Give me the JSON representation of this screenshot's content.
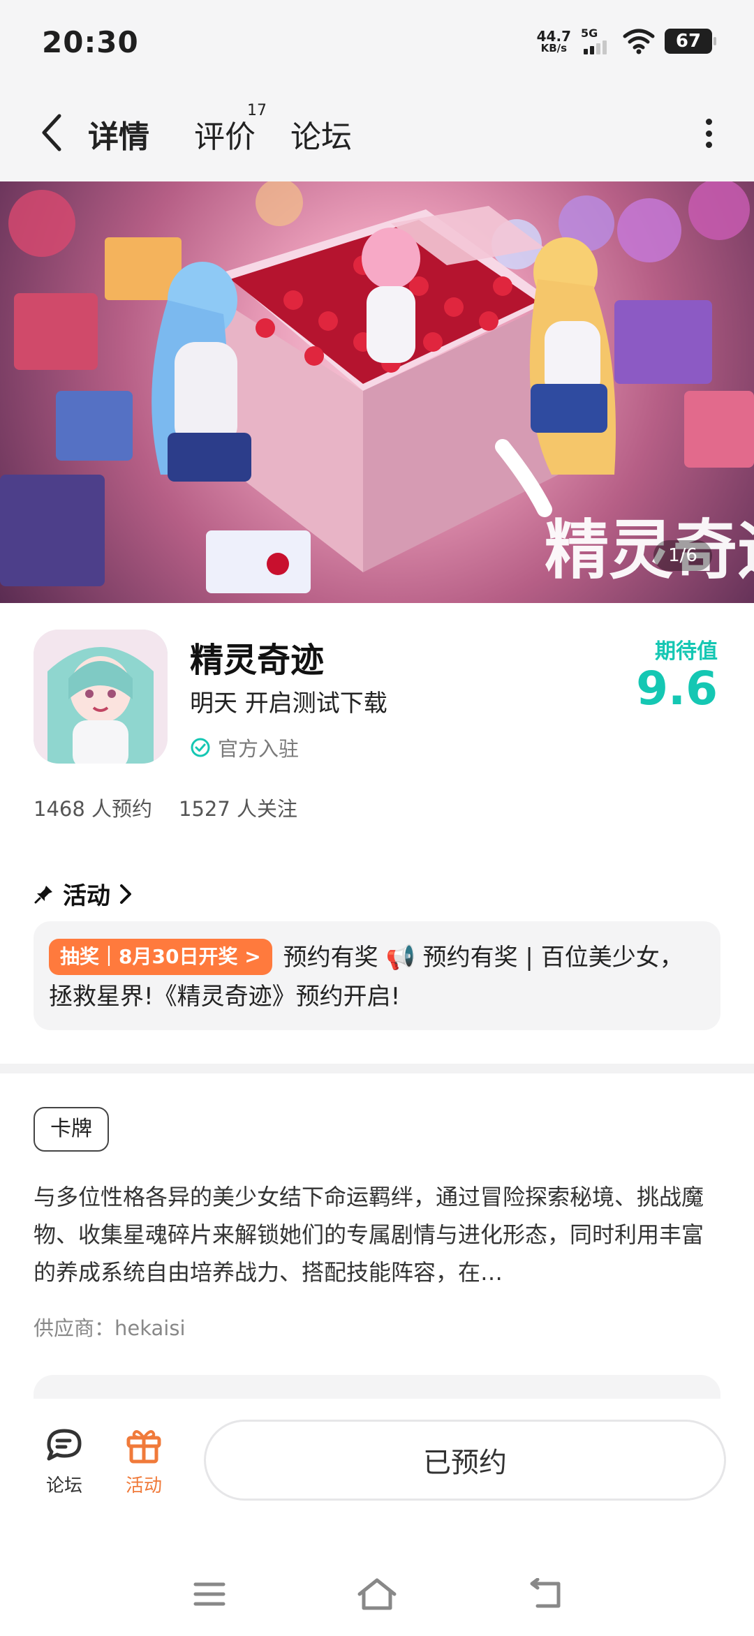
{
  "status_bar": {
    "time": "20:30",
    "net_speed_value": "44.7",
    "net_speed_unit": "KB/s",
    "network": "5G",
    "battery": "67"
  },
  "header": {
    "tabs": [
      {
        "label": "详情"
      },
      {
        "label": "评价",
        "badge": "17"
      },
      {
        "label": "论坛"
      }
    ]
  },
  "banner": {
    "counter": "1/6",
    "title_art": "精灵奇迹"
  },
  "app": {
    "name": "精灵奇迹",
    "subtitle": "明天 开启测试下载",
    "official": "官方入驻",
    "score_label": "期待值",
    "score": "9.6",
    "reservations": "1468 人预约",
    "followers": "1527 人关注"
  },
  "activity": {
    "heading": "活动",
    "tag": "抽奖｜8月30日开奖 >",
    "text": "预约有奖 📢 预约有奖 | 百位美少女，拯救星界!《精灵奇迹》预约开启!"
  },
  "details": {
    "genre": "卡牌",
    "description": "与多位性格各异的美少女结下命运羁绊，通过冒险探索秘境、挑战魔物、收集星魂碎片来解锁她们的专属剧情与进化形态，同时利用丰富的养成系统自由培养战力、搭配技能阵容，在…",
    "supplier": "供应商：hekaisi"
  },
  "bottom": {
    "forum_label": "论坛",
    "activity_label": "活动",
    "reserve_label": "已预约"
  },
  "colors": {
    "accent": "#15c7b3",
    "orange": "#ff7a3d"
  }
}
